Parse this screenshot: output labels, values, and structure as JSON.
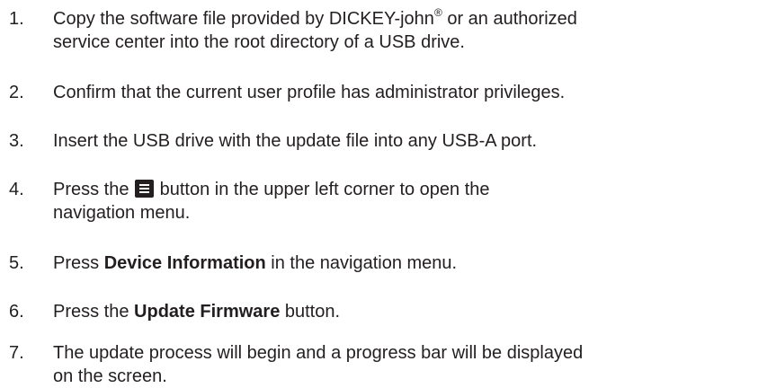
{
  "steps": [
    {
      "number": "1.",
      "line1_a": "Copy the software file provided by DICKEY-john",
      "line1_reg": "®",
      "line1_b": " or an authorized",
      "line2": "service center into the root directory of a USB drive."
    },
    {
      "number": "2.",
      "text": "Confirm that the current user profile has administrator privileges."
    },
    {
      "number": "3.",
      "text": "Insert the USB drive with the update file into any USB-A port."
    },
    {
      "number": "4.",
      "line1_a": "Press the ",
      "icon": "menu-icon",
      "line1_b": " button in the upper left corner to open the",
      "line2": "navigation menu."
    },
    {
      "number": "5.",
      "pre": "Press ",
      "bold": "Device Information",
      "post": " in the navigation menu."
    },
    {
      "number": "6.",
      "pre": "Press the ",
      "bold": "Update Firmware",
      "post": " button."
    },
    {
      "number": "7.",
      "line1": "The update process will begin and a progress bar will be displayed",
      "line2": "on the screen."
    }
  ]
}
